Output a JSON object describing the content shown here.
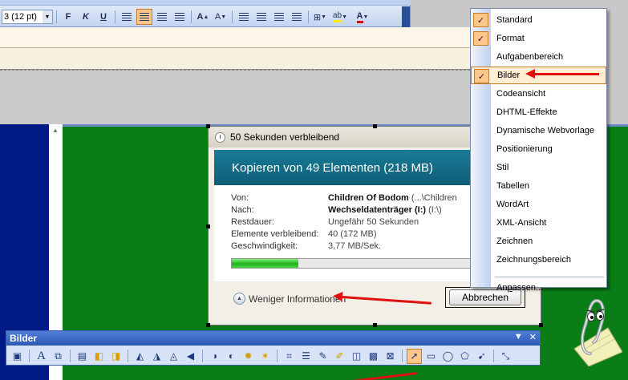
{
  "format_toolbar": {
    "font_size": "3 (12 pt)",
    "bold": "F",
    "italic": "K",
    "underline": "U",
    "grow": "A",
    "shrink": "A",
    "highlight": "ab",
    "font_color": "A"
  },
  "copy_dialog": {
    "title": "50 Sekunden verbleibend",
    "heading": "Kopieren von 49 Elementen (218 MB)",
    "rows": [
      {
        "label": "Von:",
        "value": "Children Of Bodom",
        "sub": " (...\\Children"
      },
      {
        "label": "Nach:",
        "value": "Wechseldatenträger (I:)",
        "sub": " (I:\\)"
      },
      {
        "label": "Restdauer:",
        "value": "",
        "sub": "Ungefähr 50 Sekunden"
      },
      {
        "label": "Elemente verbleibend:",
        "value": "",
        "sub": "40 (172 MB)"
      },
      {
        "label": "Geschwindigkeit:",
        "value": "",
        "sub": "3,77 MB/Sek."
      }
    ],
    "progress": 0.22,
    "less_info": "Weniger Informationen",
    "cancel": "Abbrechen"
  },
  "bilder_toolbar": {
    "title": "Bilder",
    "dropdown": "▼",
    "close": "✕"
  },
  "menu": {
    "items": [
      {
        "label": "Standard",
        "checked": true
      },
      {
        "label": "Format",
        "checked": true
      },
      {
        "label": "Aufgabenbereich",
        "checked": false
      },
      {
        "label": "Bilder",
        "checked": true
      },
      {
        "label": "Codeansicht",
        "checked": false
      },
      {
        "label": "DHTML-Effekte",
        "checked": false
      },
      {
        "label": "Dynamische Webvorlage",
        "checked": false
      },
      {
        "label": "Positionierung",
        "checked": false
      },
      {
        "label": "Stil",
        "checked": false
      },
      {
        "label": "Tabellen",
        "checked": false
      },
      {
        "label": "WordArt",
        "checked": false
      },
      {
        "label": "XML-Ansicht",
        "checked": false
      },
      {
        "label": "Zeichnen",
        "checked": false
      },
      {
        "label": "Zeichnungsbereich",
        "checked": false
      }
    ],
    "customize": {
      "pre": "An",
      "u": "p",
      "post": "assen..."
    }
  },
  "colors": {
    "highlight": "#ffc68a",
    "arrow": "#e01010",
    "doc_green": "#0b7d16",
    "doc_blue": "#001b86"
  }
}
